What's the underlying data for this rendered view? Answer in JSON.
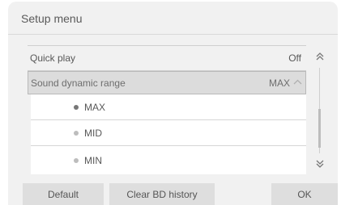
{
  "title": "Setup menu",
  "settings": [
    {
      "label": "Quick play",
      "value": "Off"
    },
    {
      "label": "Sound dynamic range",
      "value": "MAX"
    }
  ],
  "options": [
    {
      "label": "MAX",
      "selected": true
    },
    {
      "label": "MID",
      "selected": false
    },
    {
      "label": "MIN",
      "selected": false
    }
  ],
  "buttons": {
    "default": "Default",
    "clear_bd_history": "Clear BD history",
    "ok": "OK"
  },
  "icons": {
    "scroll_up": "double-chevron-up-icon",
    "scroll_down": "double-chevron-down-icon",
    "expand": "chevron-up-icon",
    "radio_selected": "filled-dot",
    "radio_unselected": "light-dot"
  },
  "colors": {
    "selected_dot": "#777777",
    "unselected_dot": "#bdbdbd",
    "panel_bg": "#f1f1f1",
    "button_bg": "#dedede"
  }
}
